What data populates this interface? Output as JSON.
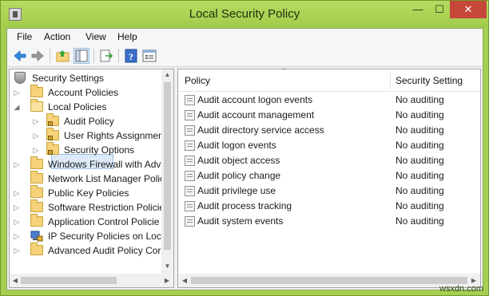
{
  "window": {
    "title": "Local Security Policy"
  },
  "title_buttons": {
    "minimize": "—",
    "maximize": "☐",
    "close": "✕"
  },
  "menubar": {
    "items": [
      "File",
      "Action",
      "View",
      "Help"
    ]
  },
  "toolbar": {
    "buttons": [
      "back-icon",
      "forward-icon",
      "up-folder-icon",
      "show-hide-tree-icon",
      "export-list-icon",
      "help-icon",
      "properties-icon"
    ]
  },
  "tree": {
    "root": "Security Settings",
    "items": [
      {
        "label": "Account Policies",
        "expander": "▷"
      },
      {
        "label": "Local Policies",
        "expander": "◢"
      },
      {
        "label": "Audit Policy",
        "expander": "▷"
      },
      {
        "label": "User Rights Assignment",
        "expander": "▷"
      },
      {
        "label": "Security Options",
        "expander": "▷"
      },
      {
        "label": "Windows Firewall with Adv",
        "expander": "▷"
      },
      {
        "label": "Network List Manager Polic",
        "expander": ""
      },
      {
        "label": "Public Key Policies",
        "expander": "▷"
      },
      {
        "label": "Software Restriction Policie",
        "expander": "▷"
      },
      {
        "label": "Application Control Policie",
        "expander": "▷"
      },
      {
        "label": "IP Security Policies on Loca",
        "expander": "▷"
      },
      {
        "label": "Advanced Audit Policy Cor",
        "expander": "▷"
      }
    ],
    "selected": "Audit Policy"
  },
  "list": {
    "columns": [
      "Policy",
      "Security Setting"
    ],
    "rows": [
      {
        "policy": "Audit account logon events",
        "setting": "No auditing"
      },
      {
        "policy": "Audit account management",
        "setting": "No auditing"
      },
      {
        "policy": "Audit directory service access",
        "setting": "No auditing"
      },
      {
        "policy": "Audit logon events",
        "setting": "No auditing"
      },
      {
        "policy": "Audit object access",
        "setting": "No auditing"
      },
      {
        "policy": "Audit policy change",
        "setting": "No auditing"
      },
      {
        "policy": "Audit privilege use",
        "setting": "No auditing"
      },
      {
        "policy": "Audit process tracking",
        "setting": "No auditing"
      },
      {
        "policy": "Audit system events",
        "setting": "No auditing"
      }
    ]
  },
  "watermark": "wsxdn.com"
}
